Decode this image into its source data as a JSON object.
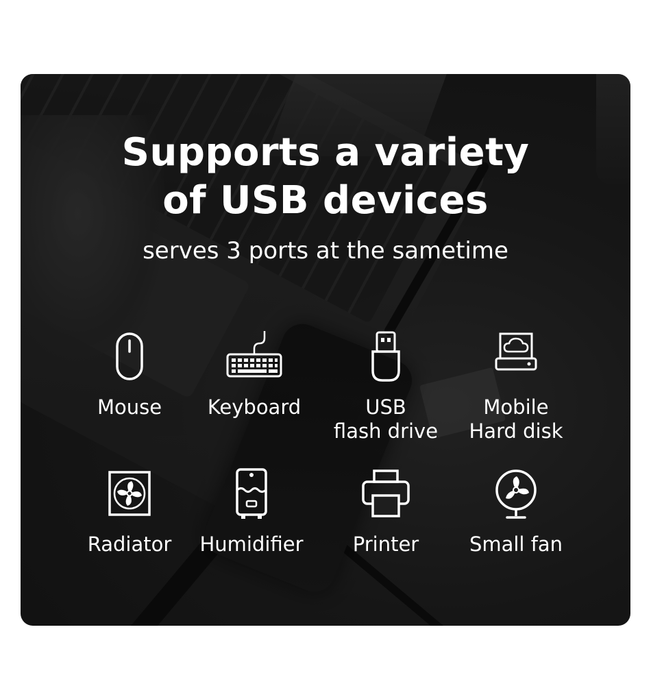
{
  "heading": {
    "line1": "Supports a variety",
    "line2": "of USB devices"
  },
  "subheading": "serves 3 ports at the sametime",
  "devices": [
    {
      "label": "Mouse",
      "icon": "mouse-icon"
    },
    {
      "label": "Keyboard",
      "icon": "keyboard-icon"
    },
    {
      "label": "USB\nflash drive",
      "icon": "usb-flash-drive-icon"
    },
    {
      "label": "Mobile\nHard disk",
      "icon": "hard-disk-icon"
    },
    {
      "label": "Radiator",
      "icon": "radiator-fan-icon"
    },
    {
      "label": "Humidifier",
      "icon": "humidifier-icon"
    },
    {
      "label": "Printer",
      "icon": "printer-icon"
    },
    {
      "label": "Small fan",
      "icon": "small-fan-icon"
    }
  ],
  "colors": {
    "background": "#ffffff",
    "panel": "#1e1e1e",
    "text": "#ffffff"
  }
}
